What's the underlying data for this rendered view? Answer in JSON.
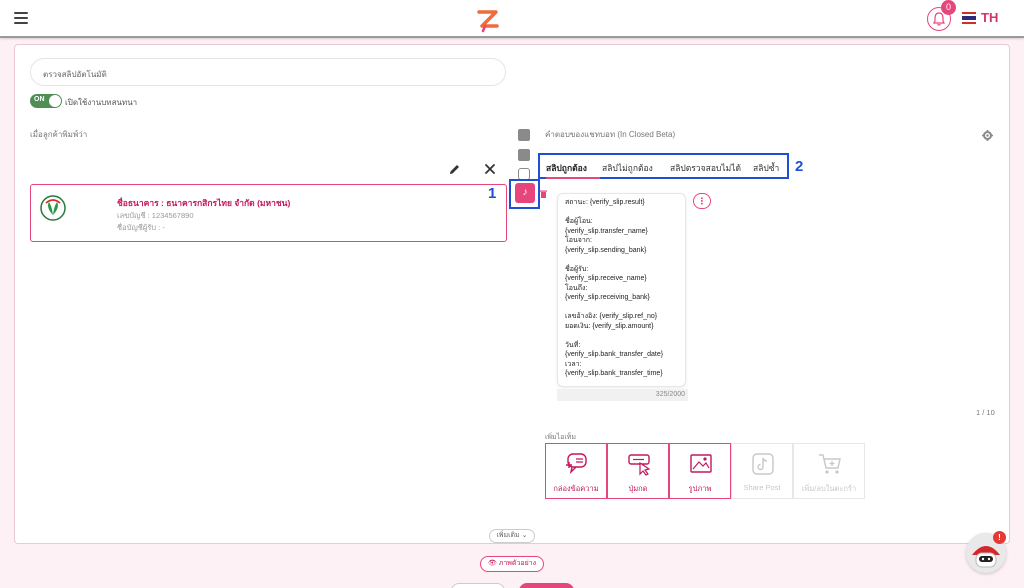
{
  "header": {
    "notification_count": "0",
    "language": "TH"
  },
  "settings": {
    "title_field": "ตรวจสลิปอัตโนมัติ",
    "toggle_state": "ON",
    "toggle_label": "เปิดใช้งานบทสนทนา"
  },
  "left_panel": {
    "heading": "เมื่อลูกค้าพิมพ์ว่า",
    "bank_card": {
      "name": "ชื่อธนาคาร : ธนาคารกสิกรไทย จำกัด (มหาชน)",
      "account": "เลขบัญชี : 1234567890",
      "holder": "ชื่อบัญชีผู้รับ : -"
    }
  },
  "annotations": {
    "marker_1": "1",
    "marker_2": "2"
  },
  "right_panel": {
    "heading": "คำตอบของแชทบอท (In Closed Beta)",
    "tabs": [
      {
        "label": "สลิปถูกต้อง"
      },
      {
        "label": "สลิปไม่ถูกต้อง"
      },
      {
        "label": "สลิปตรวจสอบไม่ได้"
      },
      {
        "label": "สลิปซ้ำ"
      }
    ],
    "message": "สถานะ: {verify_slip.result}\n\nชื่อผู้โอน:\n{verify_slip.transfer_name}\nโอนจาก:\n{verify_slip.sending_bank}\n\nชื่อผู้รับ:\n{verify_slip.receive_name}\nโอนถึง:\n{verify_slip.receiving_bank}\n\nเลขอ้างอิง: {verify_slip.ref_no}\nยอดเงิน: {verify_slip.amount}\n\nวันที่:\n{verify_slip.bank_transfer_date}\nเวลา:\n{verify_slip.bank_transfer_time}",
    "char_count": "325/2000",
    "pager": "1 / 10",
    "add_items_label": "เพิ่มไอเท็ม",
    "add_items": [
      {
        "label": "กล่องข้อความ",
        "icon": "message-box-icon"
      },
      {
        "label": "ปุ่มกด",
        "icon": "button-click-icon"
      },
      {
        "label": "รูปภาพ",
        "icon": "image-icon"
      },
      {
        "label": "Share Post",
        "icon": "tiktok-icon"
      },
      {
        "label": "เพิ่ม/ลบในตะกร้า",
        "icon": "cart-icon"
      }
    ]
  },
  "footer": {
    "more_label": "เพิ่มเติม",
    "preview_label": "ภาพตัวอย่าง"
  },
  "chat_fab": {
    "badge": "!"
  },
  "colors": {
    "accent": "#e6467b",
    "annotation": "#1f4fd6",
    "toggle": "#4f8f55"
  }
}
